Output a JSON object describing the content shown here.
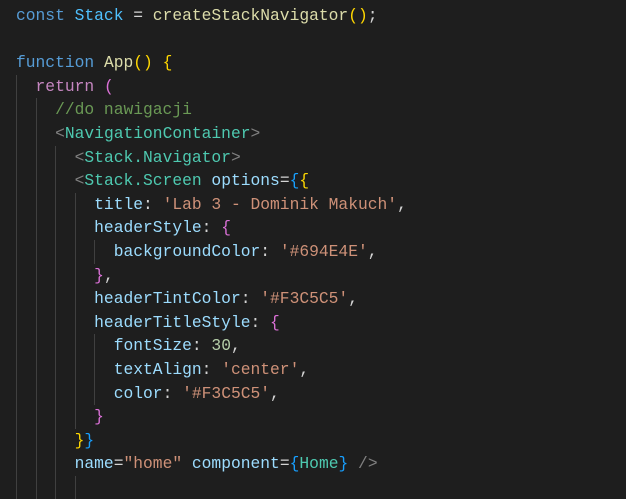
{
  "editor": {
    "lines": [
      [
        [
          "const ",
          "kw"
        ],
        [
          "Stack",
          "var"
        ],
        [
          " = ",
          "pun"
        ],
        [
          "createStackNavigator",
          "fn"
        ],
        [
          "()",
          "b1"
        ],
        [
          ";",
          "pun"
        ]
      ],
      [],
      [
        [
          "function ",
          "kw"
        ],
        [
          "App",
          "fn"
        ],
        [
          "()",
          "b1"
        ],
        [
          " ",
          "pun"
        ],
        [
          "{",
          "b1"
        ]
      ],
      [
        [
          "  return ",
          "ctl"
        ],
        [
          "(",
          "b2"
        ]
      ],
      [
        [
          "    //do nawigacji",
          "cmt"
        ]
      ],
      [
        [
          "    <",
          "ang"
        ],
        [
          "NavigationContainer",
          "tag"
        ],
        [
          ">",
          "ang"
        ]
      ],
      [
        [
          "      <",
          "ang"
        ],
        [
          "Stack.Navigator",
          "tag"
        ],
        [
          ">",
          "ang"
        ]
      ],
      [
        [
          "      <",
          "ang"
        ],
        [
          "Stack.Screen",
          "tag"
        ],
        [
          " options",
          "prop"
        ],
        [
          "=",
          "pun"
        ],
        [
          "{",
          "b3"
        ],
        [
          "{",
          "b1"
        ]
      ],
      [
        [
          "        title",
          "prop"
        ],
        [
          ": ",
          "pun"
        ],
        [
          "'Lab 3 - Dominik Makuch'",
          "str"
        ],
        [
          ",",
          "pun"
        ]
      ],
      [
        [
          "        headerStyle",
          "prop"
        ],
        [
          ": ",
          "pun"
        ],
        [
          "{",
          "b2"
        ]
      ],
      [
        [
          "          backgroundColor",
          "prop"
        ],
        [
          ": ",
          "pun"
        ],
        [
          "'#694E4E'",
          "str"
        ],
        [
          ",",
          "pun"
        ]
      ],
      [
        [
          "        ",
          "pun"
        ],
        [
          "}",
          "b2"
        ],
        [
          ",",
          "pun"
        ]
      ],
      [
        [
          "        headerTintColor",
          "prop"
        ],
        [
          ": ",
          "pun"
        ],
        [
          "'#F3C5C5'",
          "str"
        ],
        [
          ",",
          "pun"
        ]
      ],
      [
        [
          "        headerTitleStyle",
          "prop"
        ],
        [
          ": ",
          "pun"
        ],
        [
          "{",
          "b2"
        ]
      ],
      [
        [
          "          fontSize",
          "prop"
        ],
        [
          ": ",
          "pun"
        ],
        [
          "30",
          "num"
        ],
        [
          ",",
          "pun"
        ]
      ],
      [
        [
          "          textAlign",
          "prop"
        ],
        [
          ": ",
          "pun"
        ],
        [
          "'center'",
          "str"
        ],
        [
          ",",
          "pun"
        ]
      ],
      [
        [
          "          color",
          "prop"
        ],
        [
          ": ",
          "pun"
        ],
        [
          "'#F3C5C5'",
          "str"
        ],
        [
          ",",
          "pun"
        ]
      ],
      [
        [
          "        ",
          "pun"
        ],
        [
          "}",
          "b2"
        ]
      ],
      [
        [
          "      ",
          "pun"
        ],
        [
          "}",
          "b1"
        ],
        [
          "}",
          "b3"
        ]
      ],
      [
        [
          "      name",
          "prop"
        ],
        [
          "=",
          "pun"
        ],
        [
          "\"home\"",
          "str"
        ],
        [
          " component",
          "prop"
        ],
        [
          "=",
          "pun"
        ],
        [
          "{",
          "b3"
        ],
        [
          "Home",
          "tag"
        ],
        [
          "}",
          "b3"
        ],
        [
          " />",
          "ang"
        ]
      ],
      [
        [
          "        ",
          "pun"
        ]
      ]
    ]
  }
}
